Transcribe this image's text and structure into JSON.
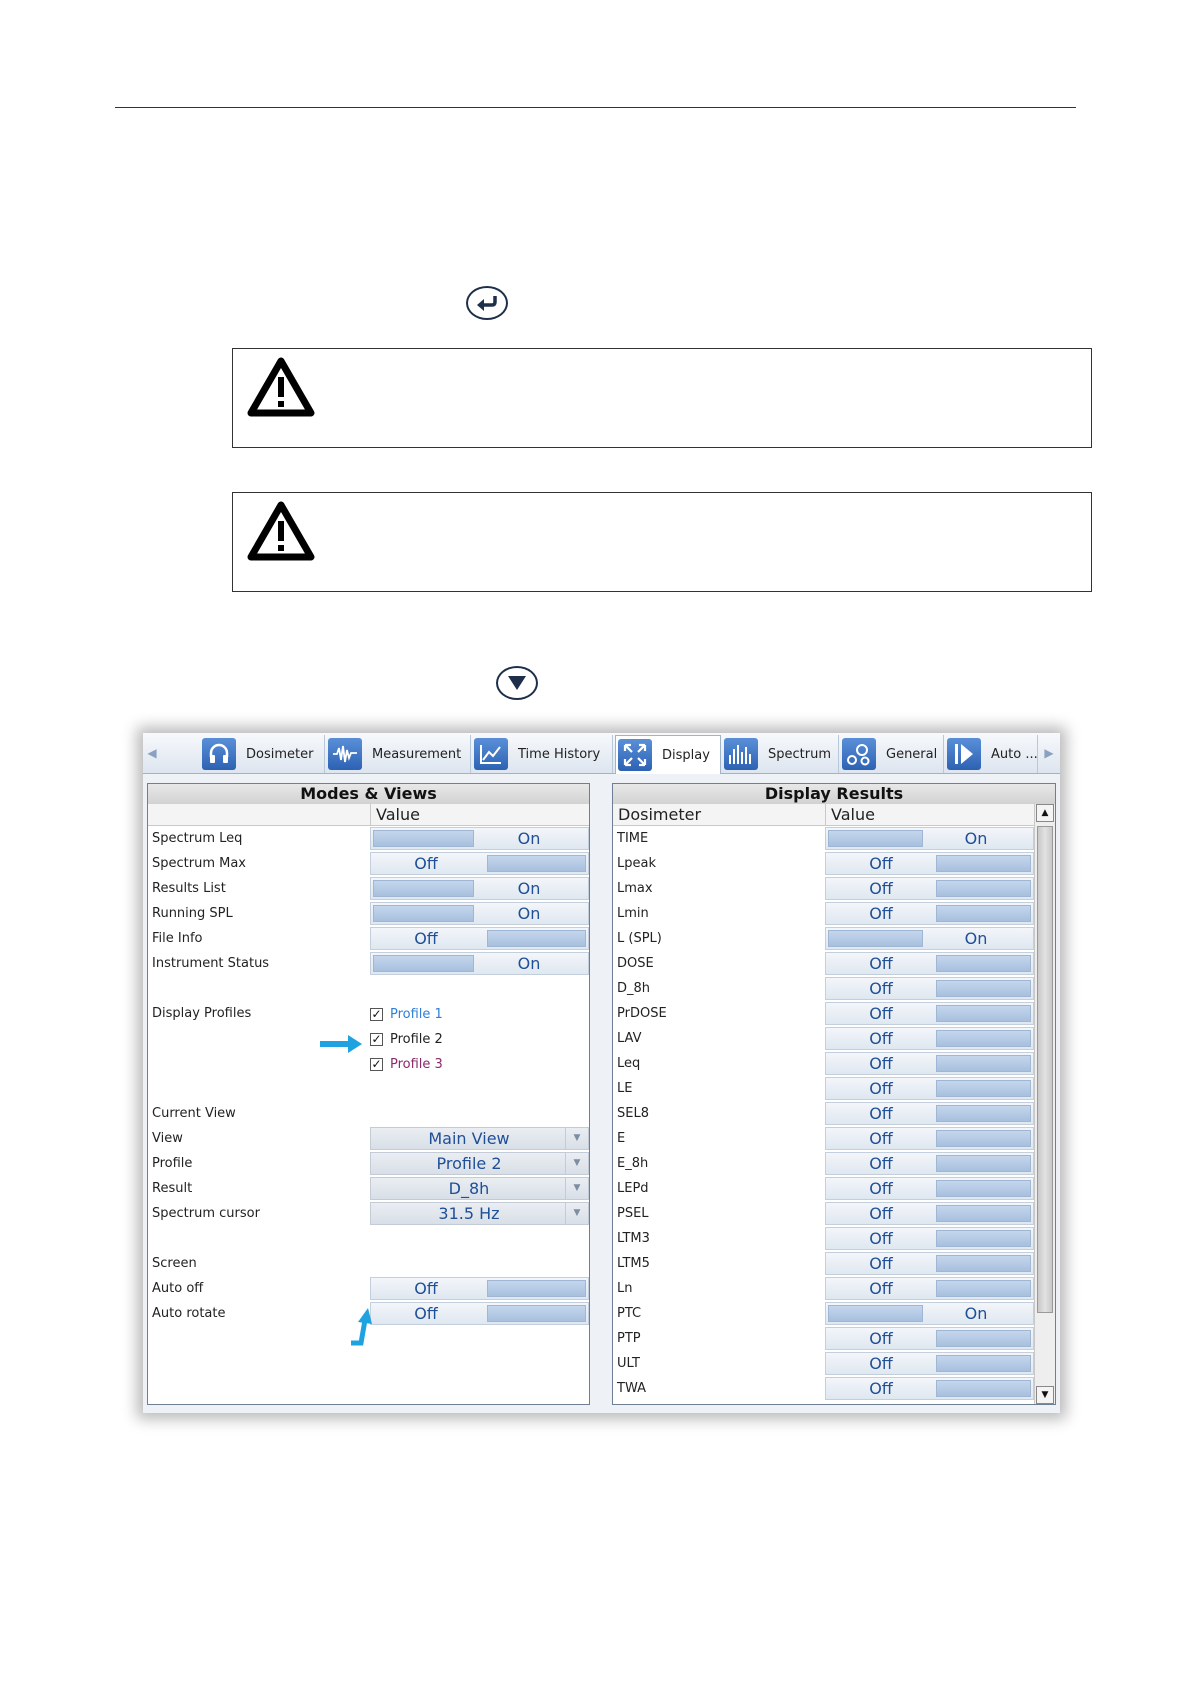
{
  "colors": {
    "accent": "#1f4f96",
    "arrow": "#1fa3e0",
    "profile1": "#2f7fd6",
    "profile3": "#8a2a6a"
  },
  "window": {
    "tabs": [
      {
        "label": "Dosimeter",
        "icon": "headphones-icon"
      },
      {
        "label": "Measurement",
        "icon": "waveform-icon"
      },
      {
        "label": "Time History",
        "icon": "line-chart-icon"
      },
      {
        "label": "Display",
        "icon": "expand-icon",
        "active": true
      },
      {
        "label": "Spectrum",
        "icon": "bars-icon"
      },
      {
        "label": "General",
        "icon": "gears-icon"
      },
      {
        "label": "Auto ...",
        "icon": "play-icon"
      }
    ],
    "modes": {
      "title": "Modes & Views",
      "value_header": "Value",
      "toggles": [
        {
          "label": "Spectrum Leq",
          "value": "On"
        },
        {
          "label": "Spectrum Max",
          "value": "Off"
        },
        {
          "label": "Results List",
          "value": "On"
        },
        {
          "label": "Running SPL",
          "value": "On"
        },
        {
          "label": "File Info",
          "value": "Off"
        },
        {
          "label": "Instrument Status",
          "value": "On"
        }
      ],
      "display_profiles_label": "Display Profiles",
      "profiles": [
        {
          "label": "Profile 1",
          "checked": true
        },
        {
          "label": "Profile 2",
          "checked": true
        },
        {
          "label": "Profile 3",
          "checked": true
        }
      ],
      "current_view_label": "Current View",
      "dropdowns": [
        {
          "label": "View",
          "value": "Main View"
        },
        {
          "label": "Profile",
          "value": "Profile 2"
        },
        {
          "label": "Result",
          "value": "D_8h"
        },
        {
          "label": "Spectrum cursor",
          "value": "31.5 Hz"
        }
      ],
      "screen_label": "Screen",
      "screen_toggles": [
        {
          "label": "Auto off",
          "value": "Off"
        },
        {
          "label": "Auto rotate",
          "value": "Off"
        }
      ]
    },
    "results": {
      "title": "Display Results",
      "name_header": "Dosimeter",
      "value_header": "Value",
      "rows": [
        {
          "label": "TIME",
          "value": "On"
        },
        {
          "label": "Lpeak",
          "value": "Off"
        },
        {
          "label": "Lmax",
          "value": "Off"
        },
        {
          "label": "Lmin",
          "value": "Off"
        },
        {
          "label": "L (SPL)",
          "value": "On"
        },
        {
          "label": "DOSE",
          "value": "Off"
        },
        {
          "label": "D_8h",
          "value": "Off"
        },
        {
          "label": "PrDOSE",
          "value": "Off"
        },
        {
          "label": "LAV",
          "value": "Off"
        },
        {
          "label": "Leq",
          "value": "Off"
        },
        {
          "label": "LE",
          "value": "Off"
        },
        {
          "label": "SEL8",
          "value": "Off"
        },
        {
          "label": "E",
          "value": "Off"
        },
        {
          "label": "E_8h",
          "value": "Off"
        },
        {
          "label": "LEPd",
          "value": "Off"
        },
        {
          "label": "PSEL",
          "value": "Off"
        },
        {
          "label": "LTM3",
          "value": "Off"
        },
        {
          "label": "LTM5",
          "value": "Off"
        },
        {
          "label": "Ln",
          "value": "Off"
        },
        {
          "label": "PTC",
          "value": "On"
        },
        {
          "label": "PTP",
          "value": "Off"
        },
        {
          "label": "ULT",
          "value": "Off"
        },
        {
          "label": "TWA",
          "value": "Off"
        }
      ]
    }
  }
}
